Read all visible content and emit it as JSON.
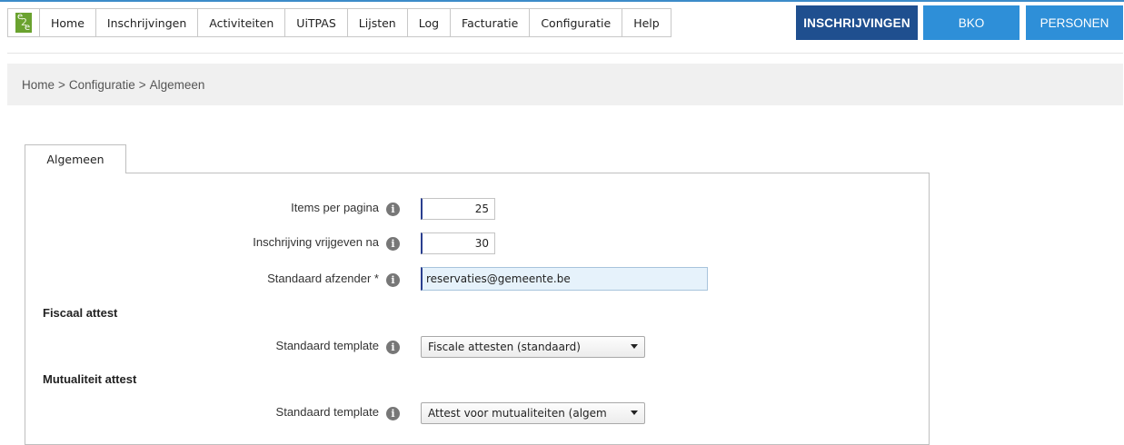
{
  "nav": {
    "logo_text": [
      "e",
      "2",
      "e"
    ],
    "items": [
      "Home",
      "Inschrijvingen",
      "Activiteiten",
      "UiTPAS",
      "Lijsten",
      "Log",
      "Facturatie",
      "Configuratie",
      "Help"
    ]
  },
  "mode_buttons": {
    "inschrijvingen": "INSCHRIJVINGEN",
    "bko": "BKO",
    "personen": "PERSONEN"
  },
  "breadcrumb": {
    "items": [
      "Home",
      "Configuratie",
      "Algemeen"
    ],
    "separator": ">"
  },
  "tab": {
    "label": "Algemeen"
  },
  "form": {
    "items_per_pagina": {
      "label": "Items per pagina",
      "value": "25"
    },
    "inschrijving_vrijgeven": {
      "label": "Inschrijving vrijgeven na",
      "value": "30"
    },
    "standaard_afzender": {
      "label": "Standaard afzender *",
      "value": "reservaties@gemeente.be"
    },
    "fiscaal": {
      "heading": "Fiscaal attest",
      "template_label": "Standaard template",
      "template_value": "Fiscale attesten (standaard)"
    },
    "mutualiteit": {
      "heading": "Mutualiteit attest",
      "template_label": "Standaard template",
      "template_value": "Attest voor mutualiteiten (algem"
    }
  },
  "colors": {
    "accent_dark": "#1f4f8f",
    "accent": "#2e8fd8",
    "logo_green": "#6aa22f"
  }
}
